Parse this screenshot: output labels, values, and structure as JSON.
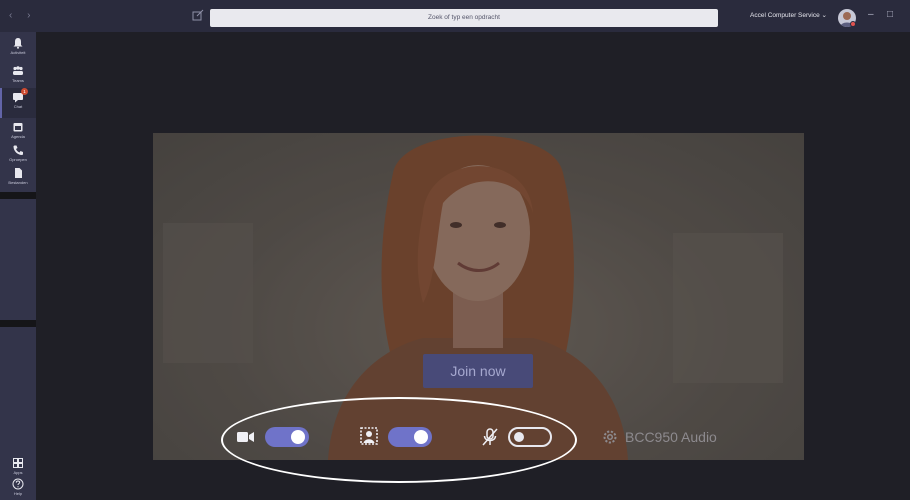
{
  "titlebar": {
    "nav_arrows": "‹ ›",
    "search_placeholder": "Zoek of typ een opdracht",
    "account_name": "Accel Computer Service ⌄",
    "minimize": "–",
    "maximize": "□"
  },
  "rail": {
    "items": [
      {
        "label": "Activiteit",
        "icon": "bell-icon"
      },
      {
        "label": "Teams",
        "icon": "teams-icon"
      },
      {
        "label": "Chat",
        "icon": "chat-icon",
        "badge": "1"
      },
      {
        "label": "Agenda",
        "icon": "calendar-icon"
      },
      {
        "label": "Oproepen",
        "icon": "phone-icon"
      },
      {
        "label": "Bestanden",
        "icon": "files-icon"
      }
    ],
    "bottom": [
      {
        "label": "Apps",
        "icon": "apps-icon"
      },
      {
        "label": "Help",
        "icon": "help-icon"
      }
    ]
  },
  "preview": {
    "join_label": "Join now",
    "camera_on": true,
    "background_blur_on": true,
    "mic_on": false,
    "device_name": "BCC950 Audio"
  },
  "colors": {
    "accent": "#6f73c9",
    "rail_bg": "#33344a",
    "titlebar_bg": "#2a2b3d",
    "app_bg": "#1f1f26",
    "join_bg": "#484a78"
  }
}
